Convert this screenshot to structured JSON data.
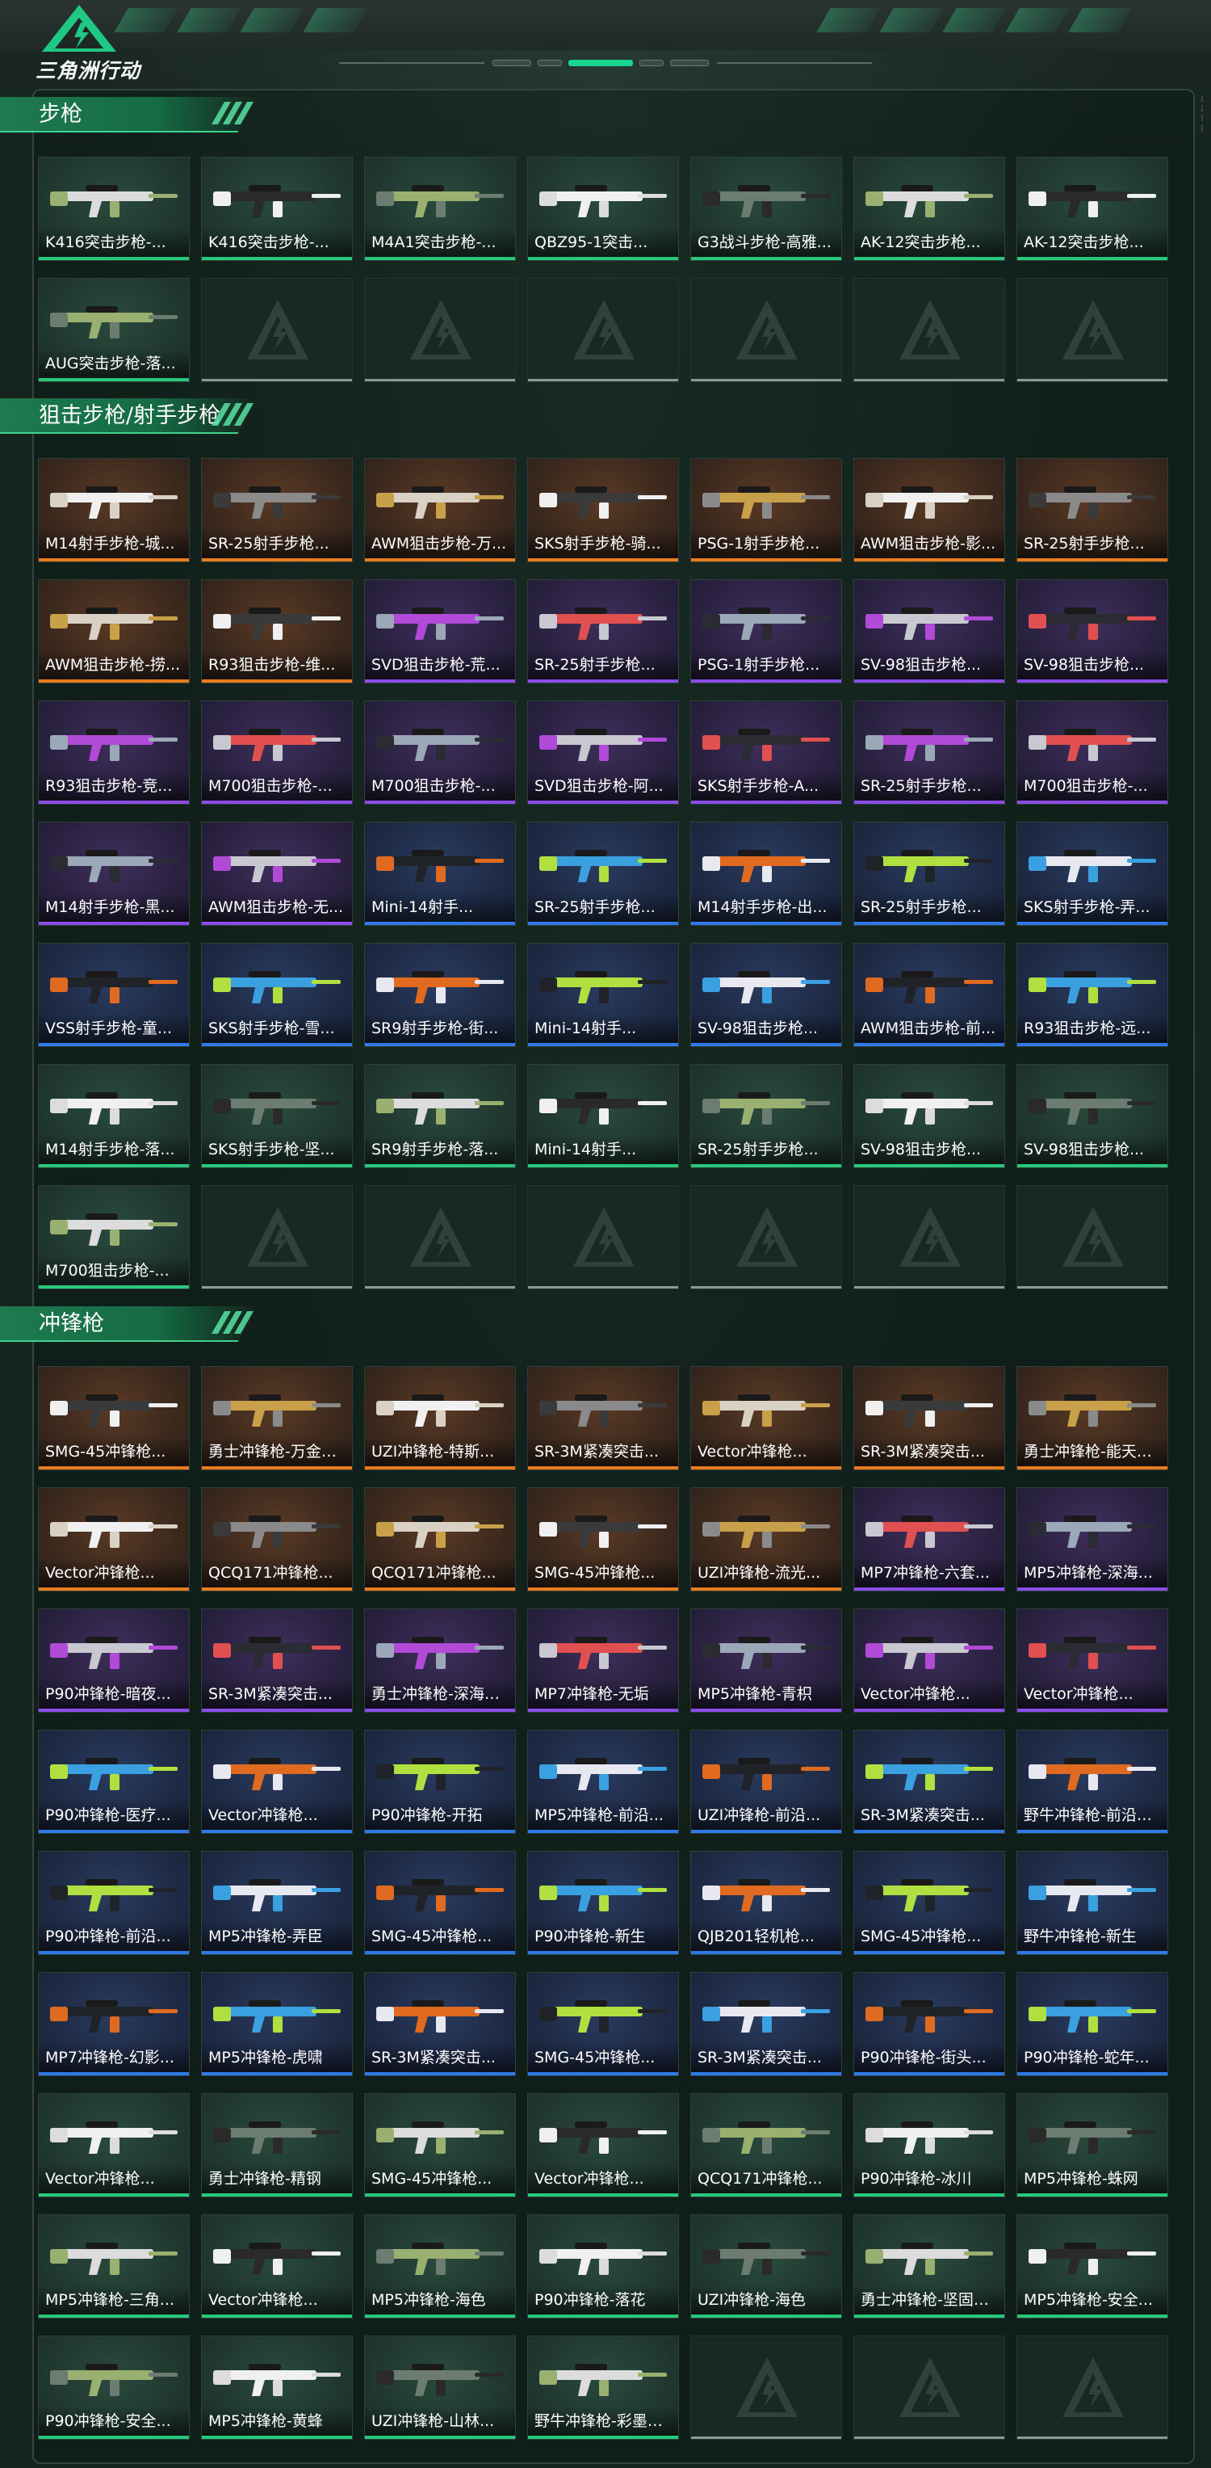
{
  "header": {
    "logo_text": "三角洲行动",
    "logo_icon": "delta-triangle-logo-icon"
  },
  "colors": {
    "orange": "#e87b1d",
    "purple": "#8b4de8",
    "blue": "#2f7ae8",
    "green": "#27c879",
    "accent": "#1bd58f"
  },
  "sections": [
    {
      "title": "步枪",
      "items": [
        {
          "name": "K416突击步枪-...",
          "rarity": "green"
        },
        {
          "name": "K416突击步枪-...",
          "rarity": "green"
        },
        {
          "name": "M4A1突击步枪-...",
          "rarity": "green"
        },
        {
          "name": "QBZ95-1突击...",
          "rarity": "green"
        },
        {
          "name": "G3战斗步枪-高雅...",
          "rarity": "green"
        },
        {
          "name": "AK-12突击步枪...",
          "rarity": "green"
        },
        {
          "name": "AK-12突击步枪...",
          "rarity": "green"
        },
        {
          "name": "AUG突击步枪-落...",
          "rarity": "green"
        }
      ]
    },
    {
      "title": "狙击步枪/射手步枪",
      "items": [
        {
          "name": "M14射手步枪-城...",
          "rarity": "orange"
        },
        {
          "name": "SR-25射手步枪...",
          "rarity": "orange"
        },
        {
          "name": "AWM狙击步枪-万...",
          "rarity": "orange"
        },
        {
          "name": "SKS射手步枪-骑...",
          "rarity": "orange"
        },
        {
          "name": "PSG-1射手步枪...",
          "rarity": "orange"
        },
        {
          "name": "AWM狙击步枪-影...",
          "rarity": "orange"
        },
        {
          "name": "SR-25射手步枪...",
          "rarity": "orange"
        },
        {
          "name": "AWM狙击步枪-捞...",
          "rarity": "orange"
        },
        {
          "name": "R93狙击步枪-维...",
          "rarity": "orange"
        },
        {
          "name": "SVD狙击步枪-荒...",
          "rarity": "purple"
        },
        {
          "name": "SR-25射手步枪...",
          "rarity": "purple"
        },
        {
          "name": "PSG-1射手步枪...",
          "rarity": "purple"
        },
        {
          "name": "SV-98狙击步枪...",
          "rarity": "purple"
        },
        {
          "name": "SV-98狙击步枪...",
          "rarity": "purple"
        },
        {
          "name": "R93狙击步枪-竞...",
          "rarity": "purple"
        },
        {
          "name": "M700狙击步枪-...",
          "rarity": "purple"
        },
        {
          "name": "M700狙击步枪-...",
          "rarity": "purple"
        },
        {
          "name": "SVD狙击步枪-阿...",
          "rarity": "purple"
        },
        {
          "name": "SKS射手步枪-A...",
          "rarity": "purple"
        },
        {
          "name": "SR-25射手步枪...",
          "rarity": "purple"
        },
        {
          "name": "M700狙击步枪-...",
          "rarity": "purple"
        },
        {
          "name": "M14射手步枪-黑...",
          "rarity": "purple"
        },
        {
          "name": "AWM狙击步枪-无...",
          "rarity": "purple"
        },
        {
          "name": "Mini-14射手...",
          "rarity": "blue"
        },
        {
          "name": "SR-25射手步枪...",
          "rarity": "blue"
        },
        {
          "name": "M14射手步枪-出...",
          "rarity": "blue"
        },
        {
          "name": "SR-25射手步枪...",
          "rarity": "blue"
        },
        {
          "name": "SKS射手步枪-弄...",
          "rarity": "blue"
        },
        {
          "name": "VSS射手步枪-童...",
          "rarity": "blue"
        },
        {
          "name": "SKS射手步枪-雪...",
          "rarity": "blue"
        },
        {
          "name": "SR9射手步枪-街...",
          "rarity": "blue"
        },
        {
          "name": "Mini-14射手...",
          "rarity": "blue"
        },
        {
          "name": "SV-98狙击步枪...",
          "rarity": "blue"
        },
        {
          "name": "AWM狙击步枪-前...",
          "rarity": "blue"
        },
        {
          "name": "R93狙击步枪-远...",
          "rarity": "blue"
        },
        {
          "name": "M14射手步枪-落...",
          "rarity": "green"
        },
        {
          "name": "SKS射手步枪-坚...",
          "rarity": "green"
        },
        {
          "name": "SR9射手步枪-落...",
          "rarity": "green"
        },
        {
          "name": "Mini-14射手...",
          "rarity": "green"
        },
        {
          "name": "SR-25射手步枪...",
          "rarity": "green"
        },
        {
          "name": "SV-98狙击步枪...",
          "rarity": "green"
        },
        {
          "name": "SV-98狙击步枪...",
          "rarity": "green"
        },
        {
          "name": "M700狙击步枪-...",
          "rarity": "green"
        }
      ]
    },
    {
      "title": "冲锋枪",
      "items": [
        {
          "name": "SMG-45冲锋枪...",
          "rarity": "orange"
        },
        {
          "name": "勇士冲锋枪-万金泪...",
          "rarity": "orange"
        },
        {
          "name": "UZI冲锋枪-特斯...",
          "rarity": "orange"
        },
        {
          "name": "SR-3M紧凑突击...",
          "rarity": "orange"
        },
        {
          "name": "Vector冲锋枪...",
          "rarity": "orange"
        },
        {
          "name": "SR-3M紧凑突击...",
          "rarity": "orange"
        },
        {
          "name": "勇士冲锋枪-能天使...",
          "rarity": "orange"
        },
        {
          "name": "Vector冲锋枪...",
          "rarity": "orange"
        },
        {
          "name": "QCQ171冲锋枪...",
          "rarity": "orange"
        },
        {
          "name": "QCQ171冲锋枪...",
          "rarity": "orange"
        },
        {
          "name": "SMG-45冲锋枪...",
          "rarity": "orange"
        },
        {
          "name": "UZI冲锋枪-流光...",
          "rarity": "orange"
        },
        {
          "name": "MP7冲锋枪-六套...",
          "rarity": "purple"
        },
        {
          "name": "MP5冲锋枪-深海...",
          "rarity": "purple"
        },
        {
          "name": "P90冲锋枪-暗夜...",
          "rarity": "purple"
        },
        {
          "name": "SR-3M紧凑突击...",
          "rarity": "purple"
        },
        {
          "name": "勇士冲锋枪-深海恐...",
          "rarity": "purple"
        },
        {
          "name": "MP7冲锋枪-无垢",
          "rarity": "purple"
        },
        {
          "name": "MP5冲锋枪-青枳",
          "rarity": "purple"
        },
        {
          "name": "Vector冲锋枪...",
          "rarity": "purple"
        },
        {
          "name": "Vector冲锋枪...",
          "rarity": "purple"
        },
        {
          "name": "P90冲锋枪-医疗...",
          "rarity": "blue"
        },
        {
          "name": "Vector冲锋枪...",
          "rarity": "blue"
        },
        {
          "name": "P90冲锋枪-开拓",
          "rarity": "blue"
        },
        {
          "name": "MP5冲锋枪-前沿...",
          "rarity": "blue"
        },
        {
          "name": "UZI冲锋枪-前沿...",
          "rarity": "blue"
        },
        {
          "name": "SR-3M紧凑突击...",
          "rarity": "blue"
        },
        {
          "name": "野牛冲锋枪-前沿科...",
          "rarity": "blue"
        },
        {
          "name": "P90冲锋枪-前沿...",
          "rarity": "blue"
        },
        {
          "name": "MP5冲锋枪-弄臣",
          "rarity": "blue"
        },
        {
          "name": "SMG-45冲锋枪...",
          "rarity": "blue"
        },
        {
          "name": "P90冲锋枪-新生",
          "rarity": "blue"
        },
        {
          "name": "QJB201轻机枪...",
          "rarity": "blue"
        },
        {
          "name": "SMG-45冲锋枪...",
          "rarity": "blue"
        },
        {
          "name": "野牛冲锋枪-新生",
          "rarity": "blue"
        },
        {
          "name": "MP7冲锋枪-幻影...",
          "rarity": "blue"
        },
        {
          "name": "MP5冲锋枪-虎啸",
          "rarity": "blue"
        },
        {
          "name": "SR-3M紧凑突击...",
          "rarity": "blue"
        },
        {
          "name": "SMG-45冲锋枪...",
          "rarity": "blue"
        },
        {
          "name": "SR-3M紧凑突击...",
          "rarity": "blue"
        },
        {
          "name": "P90冲锋枪-街头...",
          "rarity": "blue"
        },
        {
          "name": "P90冲锋枪-蛇年...",
          "rarity": "blue"
        },
        {
          "name": "Vector冲锋枪...",
          "rarity": "green"
        },
        {
          "name": "勇士冲锋枪-精钢",
          "rarity": "green"
        },
        {
          "name": "SMG-45冲锋枪...",
          "rarity": "green"
        },
        {
          "name": "Vector冲锋枪...",
          "rarity": "green"
        },
        {
          "name": "QCQ171冲锋枪...",
          "rarity": "green"
        },
        {
          "name": "P90冲锋枪-冰川",
          "rarity": "green"
        },
        {
          "name": "MP5冲锋枪-蛛网",
          "rarity": "green"
        },
        {
          "name": "MP5冲锋枪-三角...",
          "rarity": "green"
        },
        {
          "name": "Vector冲锋枪...",
          "rarity": "green"
        },
        {
          "name": "MP5冲锋枪-海色",
          "rarity": "green"
        },
        {
          "name": "P90冲锋枪-落花",
          "rarity": "green"
        },
        {
          "name": "UZI冲锋枪-海色",
          "rarity": "green"
        },
        {
          "name": "勇士冲锋枪-坚固材...",
          "rarity": "green"
        },
        {
          "name": "MP5冲锋枪-安全...",
          "rarity": "green"
        },
        {
          "name": "P90冲锋枪-安全...",
          "rarity": "green"
        },
        {
          "name": "MP5冲锋枪-黄蜂",
          "rarity": "green"
        },
        {
          "name": "UZI冲锋枪-山林...",
          "rarity": "green"
        },
        {
          "name": "野牛冲锋枪-彩墨喷...",
          "rarity": "green"
        }
      ]
    }
  ]
}
